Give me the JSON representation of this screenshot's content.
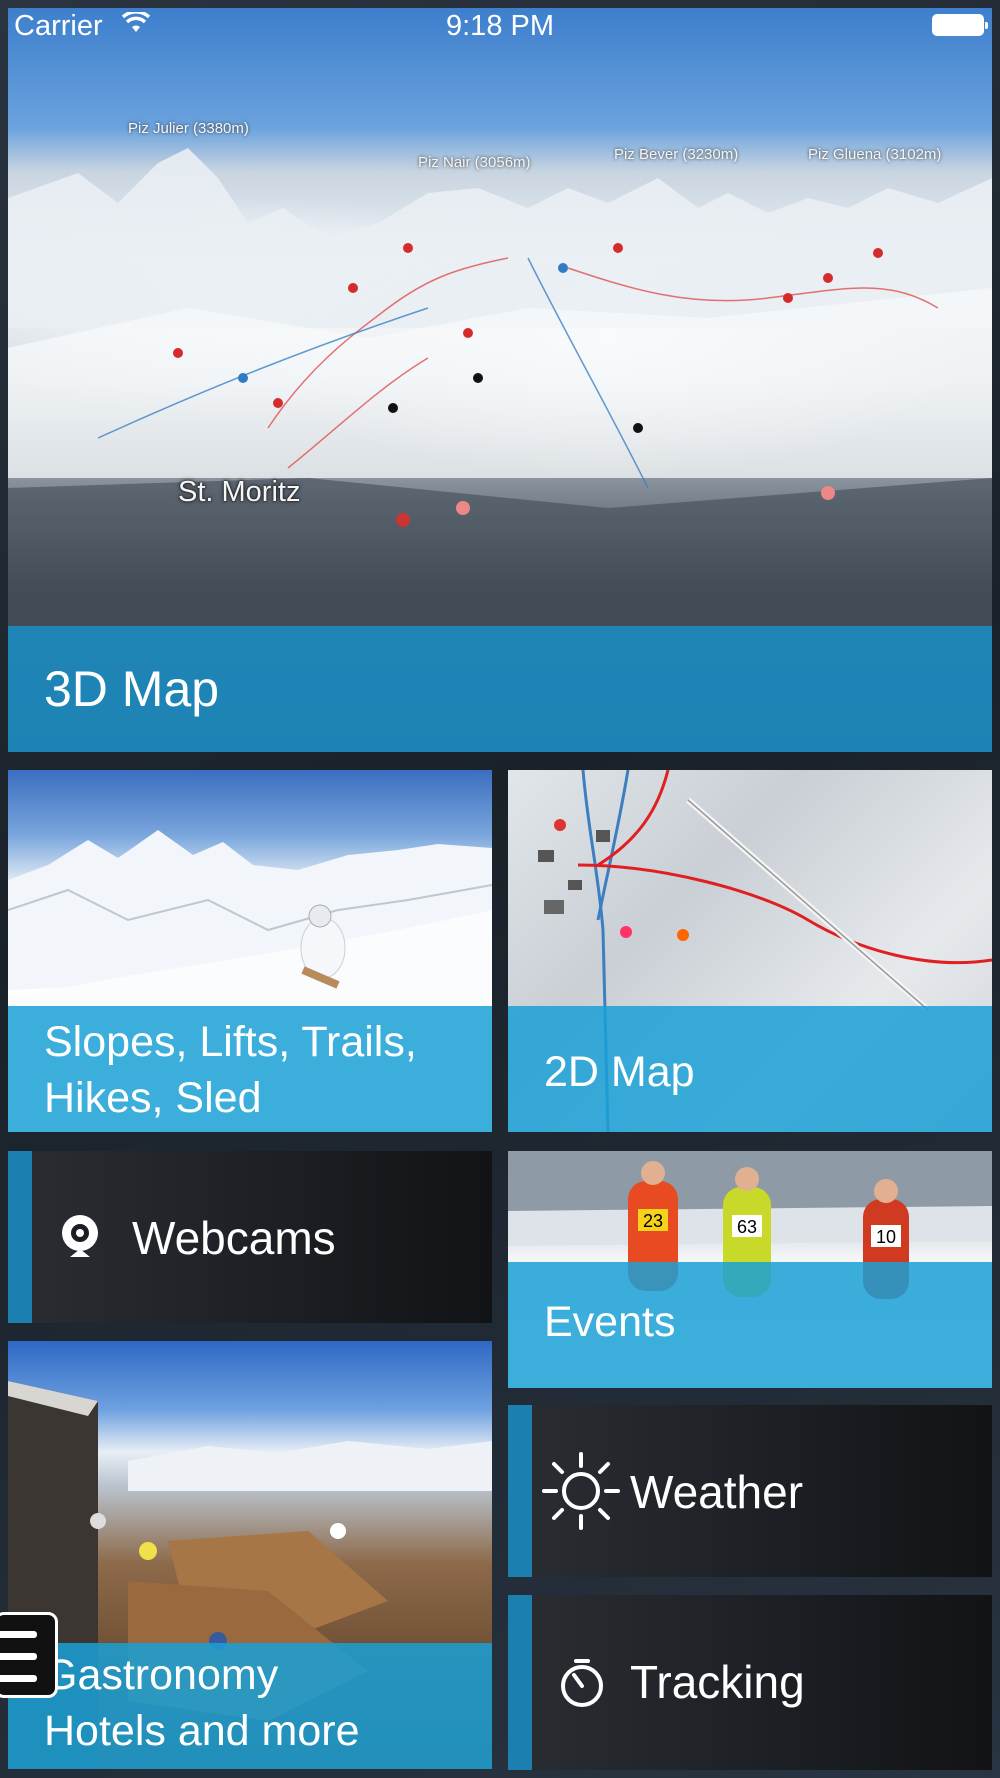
{
  "status_bar": {
    "carrier": "Carrier",
    "time": "9:18 PM",
    "wifi_icon": "wifi-icon",
    "battery_icon": "battery-icon"
  },
  "tiles": {
    "map_3d": {
      "label": "3D Map",
      "peaks": [
        "Piz Julier (3380m)",
        "Piz Nair (3056m)",
        "Piz Bever (3230m)",
        "Piz Gluena (3102m)"
      ],
      "place": "St. Moritz"
    },
    "slopes": {
      "line1": "Slopes, Lifts, Trails,",
      "line2": "Hikes, Sled"
    },
    "map_2d": {
      "label": "2D Map"
    },
    "webcams": {
      "label": "Webcams",
      "icon": "webcam-icon"
    },
    "events": {
      "label": "Events",
      "bibs": [
        "23",
        "63",
        "10"
      ]
    },
    "gastronomy": {
      "line1": "Gastronomy",
      "line2": "Hotels and more"
    },
    "weather": {
      "label": "Weather",
      "icon": "sun-icon"
    },
    "tracking": {
      "label": "Tracking",
      "icon": "stopwatch-icon"
    }
  },
  "menu": {
    "icon": "hamburger-menu-icon"
  },
  "colors": {
    "accent_blue": "#1aa0d6",
    "accent_dark_blue": "#1b7fb0",
    "dark_tile": "#1b1e22"
  }
}
